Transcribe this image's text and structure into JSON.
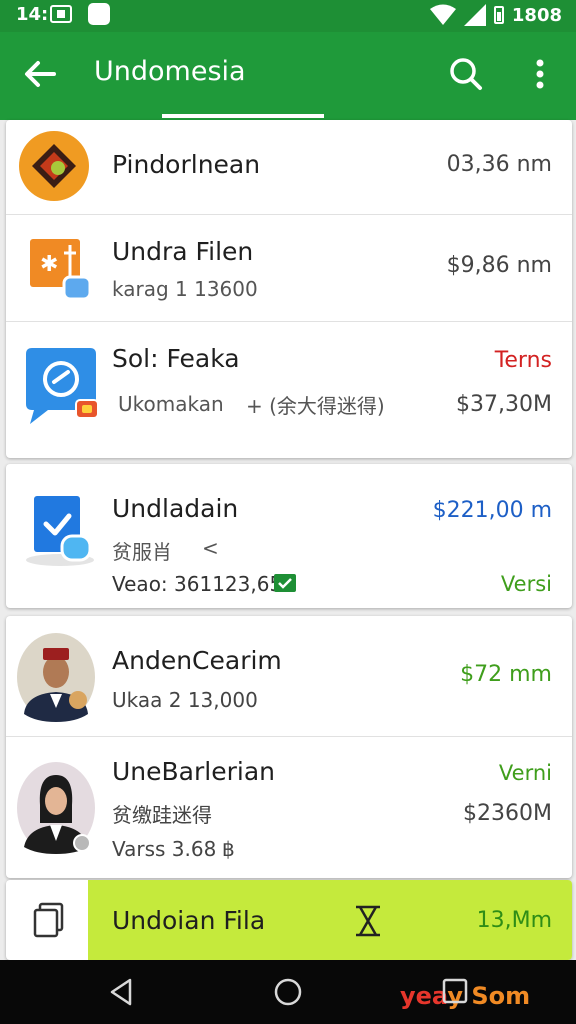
{
  "status_bar": {
    "time": "14:",
    "clock": "1808"
  },
  "app_bar": {
    "title": "Undomesia"
  },
  "items": [
    {
      "name": "Pindorlnean",
      "sub": "",
      "right_top": "03,36 nm",
      "right_bottom": ""
    },
    {
      "name": "Undra Filen",
      "sub": "karag 1 13600",
      "right_top": "$9,86 nm",
      "right_bottom": ""
    },
    {
      "name": "Sol: Feaka",
      "sub": "Ukomakan",
      "sub2": "+ (余大得迷得)",
      "right_top": "Terns",
      "right_bottom": "$37,30M"
    },
    {
      "name": "Undladain",
      "sub": "贫服肖",
      "sub_mark": "<",
      "sub3": "Veao: 361123,65",
      "right_top": "$221,00 m",
      "right_bottom": "Versi"
    },
    {
      "name": "AndenCearim",
      "sub": "Ukaa 2 13,000",
      "right_top": "$72 mm",
      "right_bottom": ""
    },
    {
      "name": "UneBarlerian",
      "sub": "贫缴跬迷得",
      "sub3": "Varss 3.68",
      "sub3_mark": "฿",
      "right_top": "Verni",
      "right_bottom": "$2360M"
    },
    {
      "name": "Undoian Fila",
      "right_top": "13,Mm"
    }
  ],
  "watermark": {
    "part1": "yea",
    "part2": "y Som"
  },
  "colors": {
    "primary_green": "#1f9a3a",
    "status_green": "#1e8f35",
    "accent_lime": "#c5ea3c",
    "positive_green": "#3f9e1c",
    "alert_red": "#d32222",
    "link_blue": "#1d5fc6"
  },
  "icons": [
    "back-arrow-icon",
    "search-icon",
    "more-vert-icon",
    "wifi-icon",
    "signal-icon",
    "battery-icon",
    "file-icon",
    "hourglass-icon",
    "nav-back-icon",
    "nav-home-icon",
    "nav-recent-icon"
  ]
}
